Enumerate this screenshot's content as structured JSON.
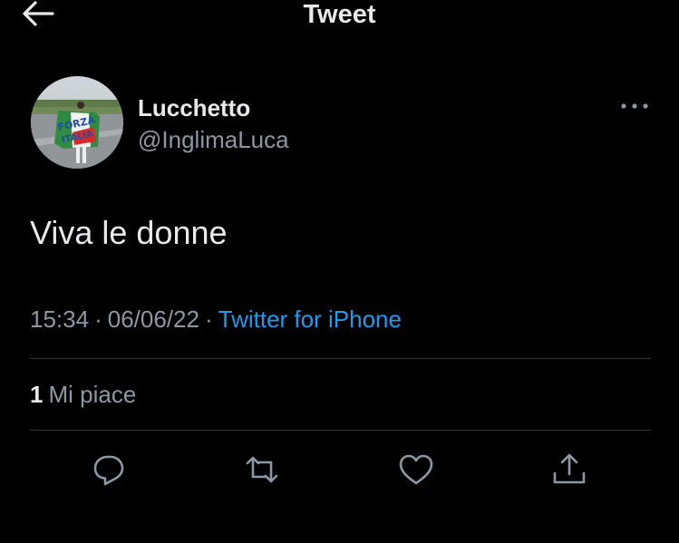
{
  "header": {
    "title": "Tweet",
    "back_icon": "arrow-left-icon"
  },
  "tweet": {
    "author_name": "Lucchetto",
    "author_handle": "@InglimaLuca",
    "avatar_flag_text": "FORZA ITALIA",
    "text": "Viva le donne",
    "time": "15:34",
    "date": "06/06/22",
    "separator": "·",
    "source": "Twitter for iPhone",
    "likes_count": "1",
    "likes_label": "Mi piace"
  },
  "actions": [
    {
      "name": "reply",
      "icon": "reply-icon"
    },
    {
      "name": "retweet",
      "icon": "retweet-icon"
    },
    {
      "name": "like",
      "icon": "heart-icon"
    },
    {
      "name": "share",
      "icon": "share-icon"
    }
  ],
  "colors": {
    "background": "#000000",
    "text": "#e7e9ea",
    "muted": "#8b98a5",
    "accent": "#1d9bf0",
    "divider": "#2f3336"
  }
}
